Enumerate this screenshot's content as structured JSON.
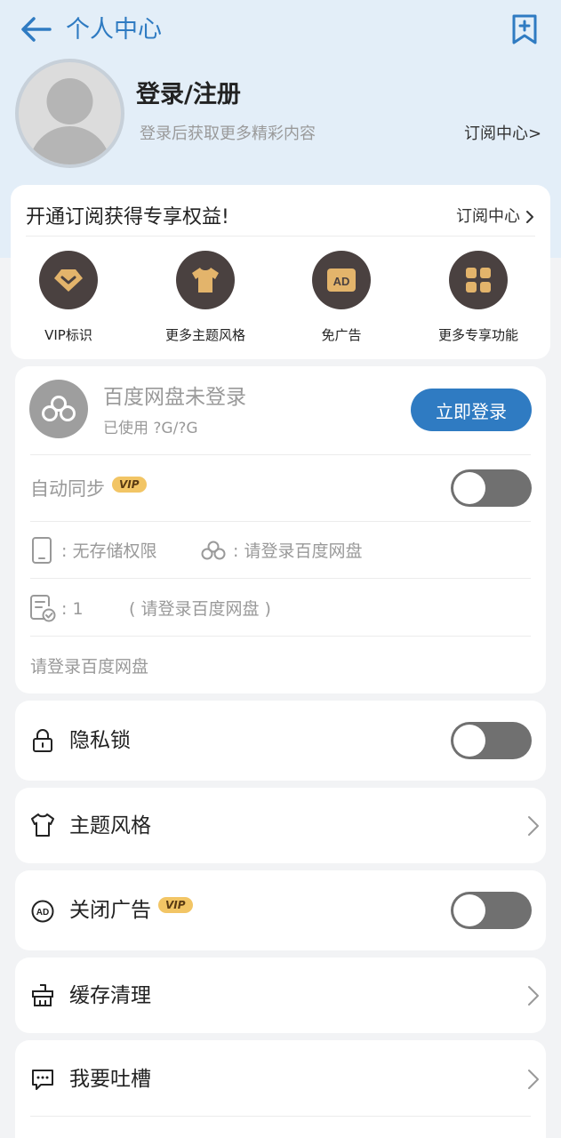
{
  "header": {
    "title": "个人中心"
  },
  "profile": {
    "login_title": "登录/注册",
    "login_subtitle": "登录后获取更多精彩内容",
    "subscription_link": "订阅中心>"
  },
  "vip_card": {
    "title": "开通订阅获得专享权益!",
    "link": "订阅中心",
    "perks": [
      {
        "label": "VIP标识",
        "icon": "vip-diamond-icon"
      },
      {
        "label": "更多主题风格",
        "icon": "tshirt-icon"
      },
      {
        "label": "免广告",
        "icon": "ad-icon"
      },
      {
        "label": "更多专享功能",
        "icon": "grid-icon"
      }
    ]
  },
  "baidu": {
    "name": "百度网盘未登录",
    "used": "已使用 ?G/?G",
    "login_button": "立即登录",
    "auto_sync_label": "自动同步",
    "vip_badge": "VIP",
    "auto_sync_on": false,
    "storage_label": ": 无存储权限",
    "cloud_label": ": 请登录百度网盘",
    "file_count": ": 1",
    "file_hint": "( 请登录百度网盘 )",
    "footer_hint": "请登录百度网盘"
  },
  "settings": {
    "privacy_lock": {
      "label": "隐私锁",
      "on": false
    },
    "theme": {
      "label": "主题风格"
    },
    "close_ads": {
      "label": "关闭广告",
      "badge": "VIP",
      "on": false
    },
    "cache": {
      "label": "缓存清理"
    },
    "feedback": {
      "label": "我要吐槽"
    }
  },
  "colors": {
    "accent": "#2f7bc2",
    "header_bg": "#e3eef8",
    "perk_circle": "#4a4140",
    "perk_icon": "#e3b46b",
    "vip_badge": "#f2c565"
  }
}
